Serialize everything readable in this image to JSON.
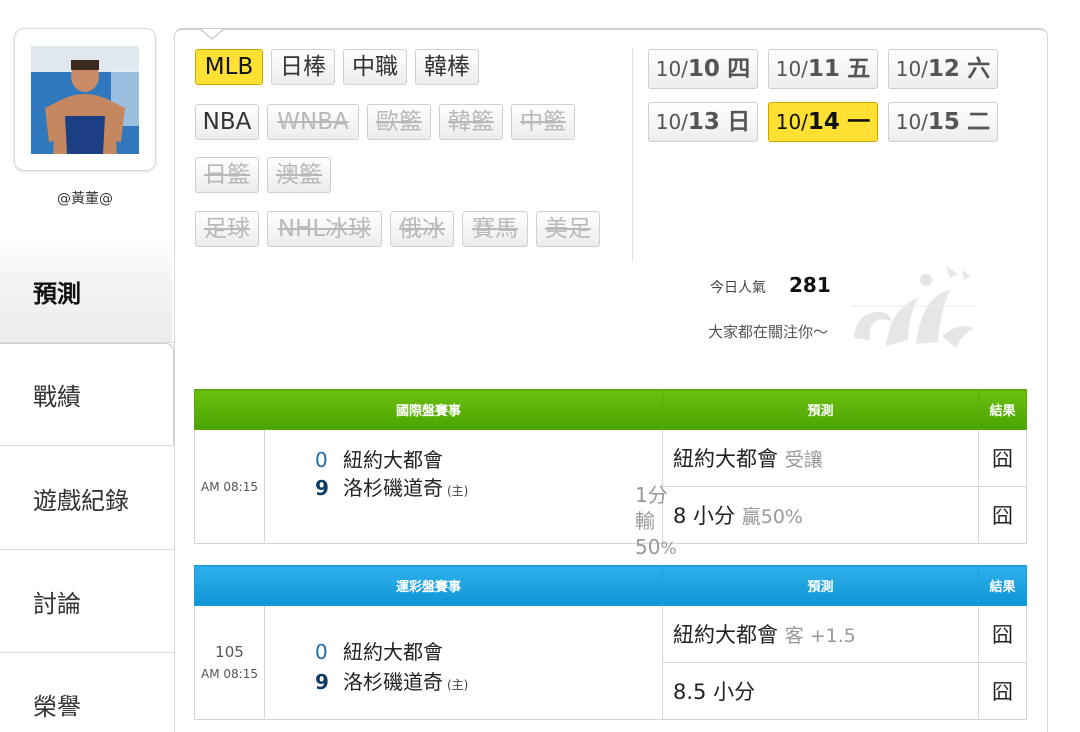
{
  "profile": {
    "username": "@黃董@",
    "avatar_alt": "avatar"
  },
  "nav": {
    "items": [
      {
        "label": "預測",
        "active": true
      },
      {
        "label": "戰績",
        "active": false
      },
      {
        "label": "遊戲紀錄",
        "active": false
      },
      {
        "label": "討論",
        "active": false
      },
      {
        "label": "榮譽",
        "active": false
      }
    ]
  },
  "sports": {
    "row1": [
      {
        "label": "MLB",
        "state": "active"
      },
      {
        "label": "日棒",
        "state": "normal"
      },
      {
        "label": "中職",
        "state": "normal"
      },
      {
        "label": "韓棒",
        "state": "normal"
      }
    ],
    "row2": [
      {
        "label": "NBA",
        "state": "normal"
      },
      {
        "label": "WNBA",
        "state": "disabled"
      },
      {
        "label": "歐籃",
        "state": "disabled"
      },
      {
        "label": "韓籃",
        "state": "disabled"
      },
      {
        "label": "中籃",
        "state": "disabled"
      }
    ],
    "row3": [
      {
        "label": "日籃",
        "state": "disabled"
      },
      {
        "label": "澳籃",
        "state": "disabled"
      }
    ],
    "row4": [
      {
        "label": "足球",
        "state": "disabled"
      },
      {
        "label": "NHL冰球",
        "state": "disabled"
      },
      {
        "label": "俄冰",
        "state": "disabled"
      },
      {
        "label": "賽馬",
        "state": "disabled"
      },
      {
        "label": "美足",
        "state": "disabled"
      }
    ]
  },
  "dates": [
    {
      "md": "10/",
      "dd": "10",
      "wd": "四",
      "active": false
    },
    {
      "md": "10/",
      "dd": "11",
      "wd": "五",
      "active": false
    },
    {
      "md": "10/",
      "dd": "12",
      "wd": "六",
      "active": false
    },
    {
      "md": "10/",
      "dd": "13",
      "wd": "日",
      "active": false
    },
    {
      "md": "10/",
      "dd": "14",
      "wd": "一",
      "active": true
    },
    {
      "md": "10/",
      "dd": "15",
      "wd": "二",
      "active": false
    }
  ],
  "popularity": {
    "label": "今日人氣",
    "value": "281",
    "subtitle": "大家都在關注你～"
  },
  "intl_table": {
    "header_game": "國際盤賽事",
    "header_pred": "預測",
    "header_result": "結果",
    "time": "AM 08:15",
    "away_score": "0",
    "away_team": "紐約大都會",
    "home_score": "9",
    "home_team": "洛杉磯道奇",
    "home_mark": "(主)",
    "handicap_line1": "1分輸",
    "handicap_line2": "50",
    "handicap_pct": "%",
    "pred1_main": "紐約大都會",
    "pred1_sub": "受讓",
    "pred1_result": "囧",
    "pred2_main": "8 小分",
    "pred2_sub": "贏50%",
    "pred2_result": "囧"
  },
  "lottery_table": {
    "header_game": "運彩盤賽事",
    "header_pred": "預測",
    "header_result": "結果",
    "game_no": "105",
    "time": "AM 08:15",
    "away_score": "0",
    "away_team": "紐約大都會",
    "home_score": "9",
    "home_team": "洛杉磯道奇",
    "home_mark": "(主)",
    "pred1_main": "紐約大都會",
    "pred1_sub": "客 +1.5",
    "pred1_result": "囧",
    "pred2_main": "8.5 小分",
    "pred2_result": "囧"
  },
  "colors": {
    "active_yellow": "#ffe033",
    "header_green": "#5bb108",
    "header_blue": "#1ea2e0",
    "score_blue": "#1e6aa6"
  }
}
